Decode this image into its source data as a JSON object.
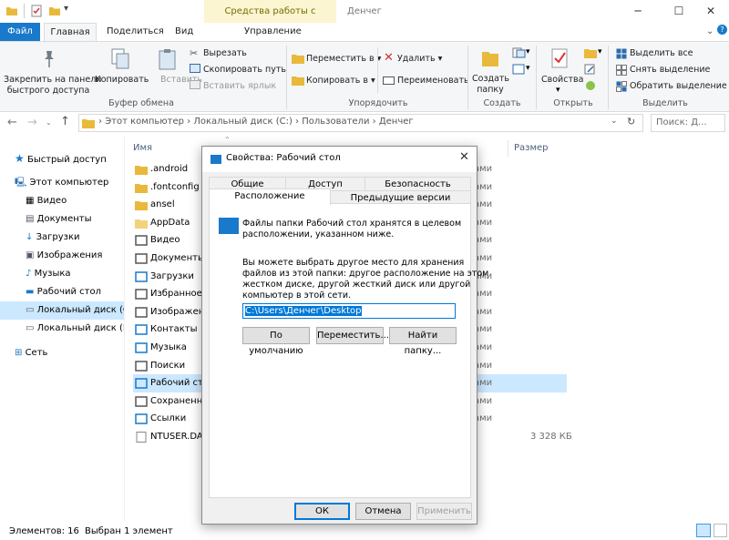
{
  "window": {
    "title": "Денчег",
    "context_tab": "Средства работы с рисунками"
  },
  "ribbon_tabs": {
    "file": "Файл",
    "home": "Главная",
    "share": "Поделиться",
    "view": "Вид",
    "manage": "Управление"
  },
  "ribbon": {
    "pin_line1": "Закрепить на панели",
    "pin_line2": "быстрого доступа",
    "copy": "Копировать",
    "paste": "Вставить",
    "cut": "Вырезать",
    "copy_path": "Скопировать путь",
    "paste_shortcut": "Вставить ярлык",
    "group_clipboard": "Буфер обмена",
    "move_to": "Переместить в",
    "copy_to": "Копировать в",
    "delete": "Удалить",
    "rename": "Переименовать",
    "group_organize": "Упорядочить",
    "new_folder_line1": "Создать",
    "new_folder_line2": "папку",
    "group_new": "Создать",
    "properties": "Свойства",
    "group_open": "Открыть",
    "select_all": "Выделить все",
    "select_none": "Снять выделение",
    "invert_selection": "Обратить выделение",
    "group_select": "Выделить"
  },
  "address": {
    "segments": [
      "Этот компьютер",
      "Локальный диск (C:)",
      "Пользователи",
      "Денчег"
    ],
    "search_placeholder": "Поиск: Д..."
  },
  "nav": {
    "quick_access": "Быстрый доступ",
    "this_pc": "Этот компьютер",
    "videos": "Видео",
    "documents": "Документы",
    "downloads": "Загрузки",
    "pictures": "Изображения",
    "music": "Музыка",
    "desktop": "Рабочий стол",
    "drive_c": "Локальный диск (C:)",
    "drive_e": "Локальный диск (E:)",
    "network": "Сеть"
  },
  "columns": {
    "name": "Имя",
    "size": "Размер"
  },
  "files": [
    {
      "name": ".android",
      "type_tail": "ами"
    },
    {
      "name": ".fontconfig",
      "type_tail": "ами"
    },
    {
      "name": "ansel",
      "type_tail": "ами"
    },
    {
      "name": "AppData",
      "type_tail": "ами"
    },
    {
      "name": "Видео",
      "type_tail": "ами"
    },
    {
      "name": "Документы",
      "type_tail": "ами"
    },
    {
      "name": "Загрузки",
      "type_tail": "ами"
    },
    {
      "name": "Избранное",
      "type_tail": "ами"
    },
    {
      "name": "Изображения",
      "type_tail": "ами"
    },
    {
      "name": "Контакты",
      "type_tail": "ами"
    },
    {
      "name": "Музыка",
      "type_tail": "ами"
    },
    {
      "name": "Поиски",
      "type_tail": "ами"
    },
    {
      "name": "Рабочий стол",
      "type_tail": "ами"
    },
    {
      "name": "Сохраненн",
      "type_tail": "ами"
    },
    {
      "name": "Ссылки",
      "type_tail": "ами"
    },
    {
      "name": "NTUSER.DAT",
      "type_tail": "",
      "size": "3 328 КБ"
    }
  ],
  "status": {
    "items_count": "Элементов: 16",
    "selected": "Выбран 1 элемент"
  },
  "dialog": {
    "title": "Свойства: Рабочий стол",
    "tabs": {
      "general": "Общие",
      "access": "Доступ",
      "security": "Безопасность",
      "location": "Расположение",
      "previous_versions": "Предыдущие версии"
    },
    "info_line1": "Файлы папки Рабочий стол хранятся в целевом",
    "info_line2": "расположении, указанном ниже.",
    "desc_line1": "Вы можете выбрать другое место для хранения",
    "desc_line2": "файлов из этой папки: другое расположение на этом",
    "desc_line3": "жестком диске, другой жесткий диск или другой",
    "desc_line4": "компьютер в этой сети.",
    "path_value": "C:\\Users\\Денчег\\Desktop",
    "btn_default": "По умолчанию",
    "btn_move": "Переместить...",
    "btn_find": "Найти папку...",
    "btn_ok": "ОК",
    "btn_cancel": "Отмена",
    "btn_apply": "Применить"
  },
  "colors": {
    "accent": "#1979ca",
    "folder": "#e8b93a",
    "selection": "#cce8ff"
  }
}
